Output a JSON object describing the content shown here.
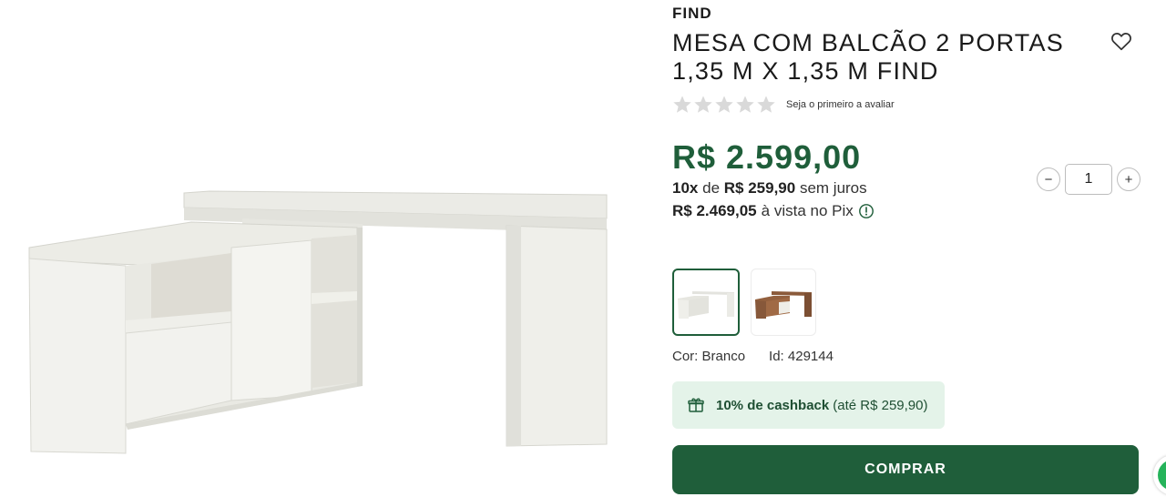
{
  "product": {
    "brand": "FIND",
    "title": "MESA COM BALCÃO 2 PORTAS 1,35 M X 1,35 M FIND",
    "favorite_icon": "heart-outline-icon",
    "rating": {
      "stars_filled": 0,
      "stars_total": 5,
      "text": "Seja o primeiro a avaliar",
      "star_color": "#d9d9d9"
    },
    "price": "R$ 2.599,00",
    "installments": {
      "count": "10x",
      "connector": "de",
      "amount": "R$ 259,90",
      "suffix": "sem juros"
    },
    "pix": {
      "amount": "R$ 2.469,05",
      "suffix": "à vista no Pix",
      "icon": "info-circle-icon"
    },
    "quantity": {
      "value": "1",
      "minus_label": "−",
      "plus_label": "+"
    },
    "swatches": [
      {
        "name": "Branco",
        "selected": true
      },
      {
        "name": "Amadeirado",
        "selected": false
      }
    ],
    "color_label": "Cor: Branco",
    "id_label": "Id: 429144",
    "cashback": {
      "icon": "gift-icon",
      "bold": "10% de cashback",
      "rest": "(até R$ 259,90)"
    },
    "buy_label": "COMPRAR"
  },
  "colors": {
    "brand_green": "#1f5e3a",
    "cashback_bg": "#e4f3e9",
    "chat_green": "#25b35a"
  }
}
